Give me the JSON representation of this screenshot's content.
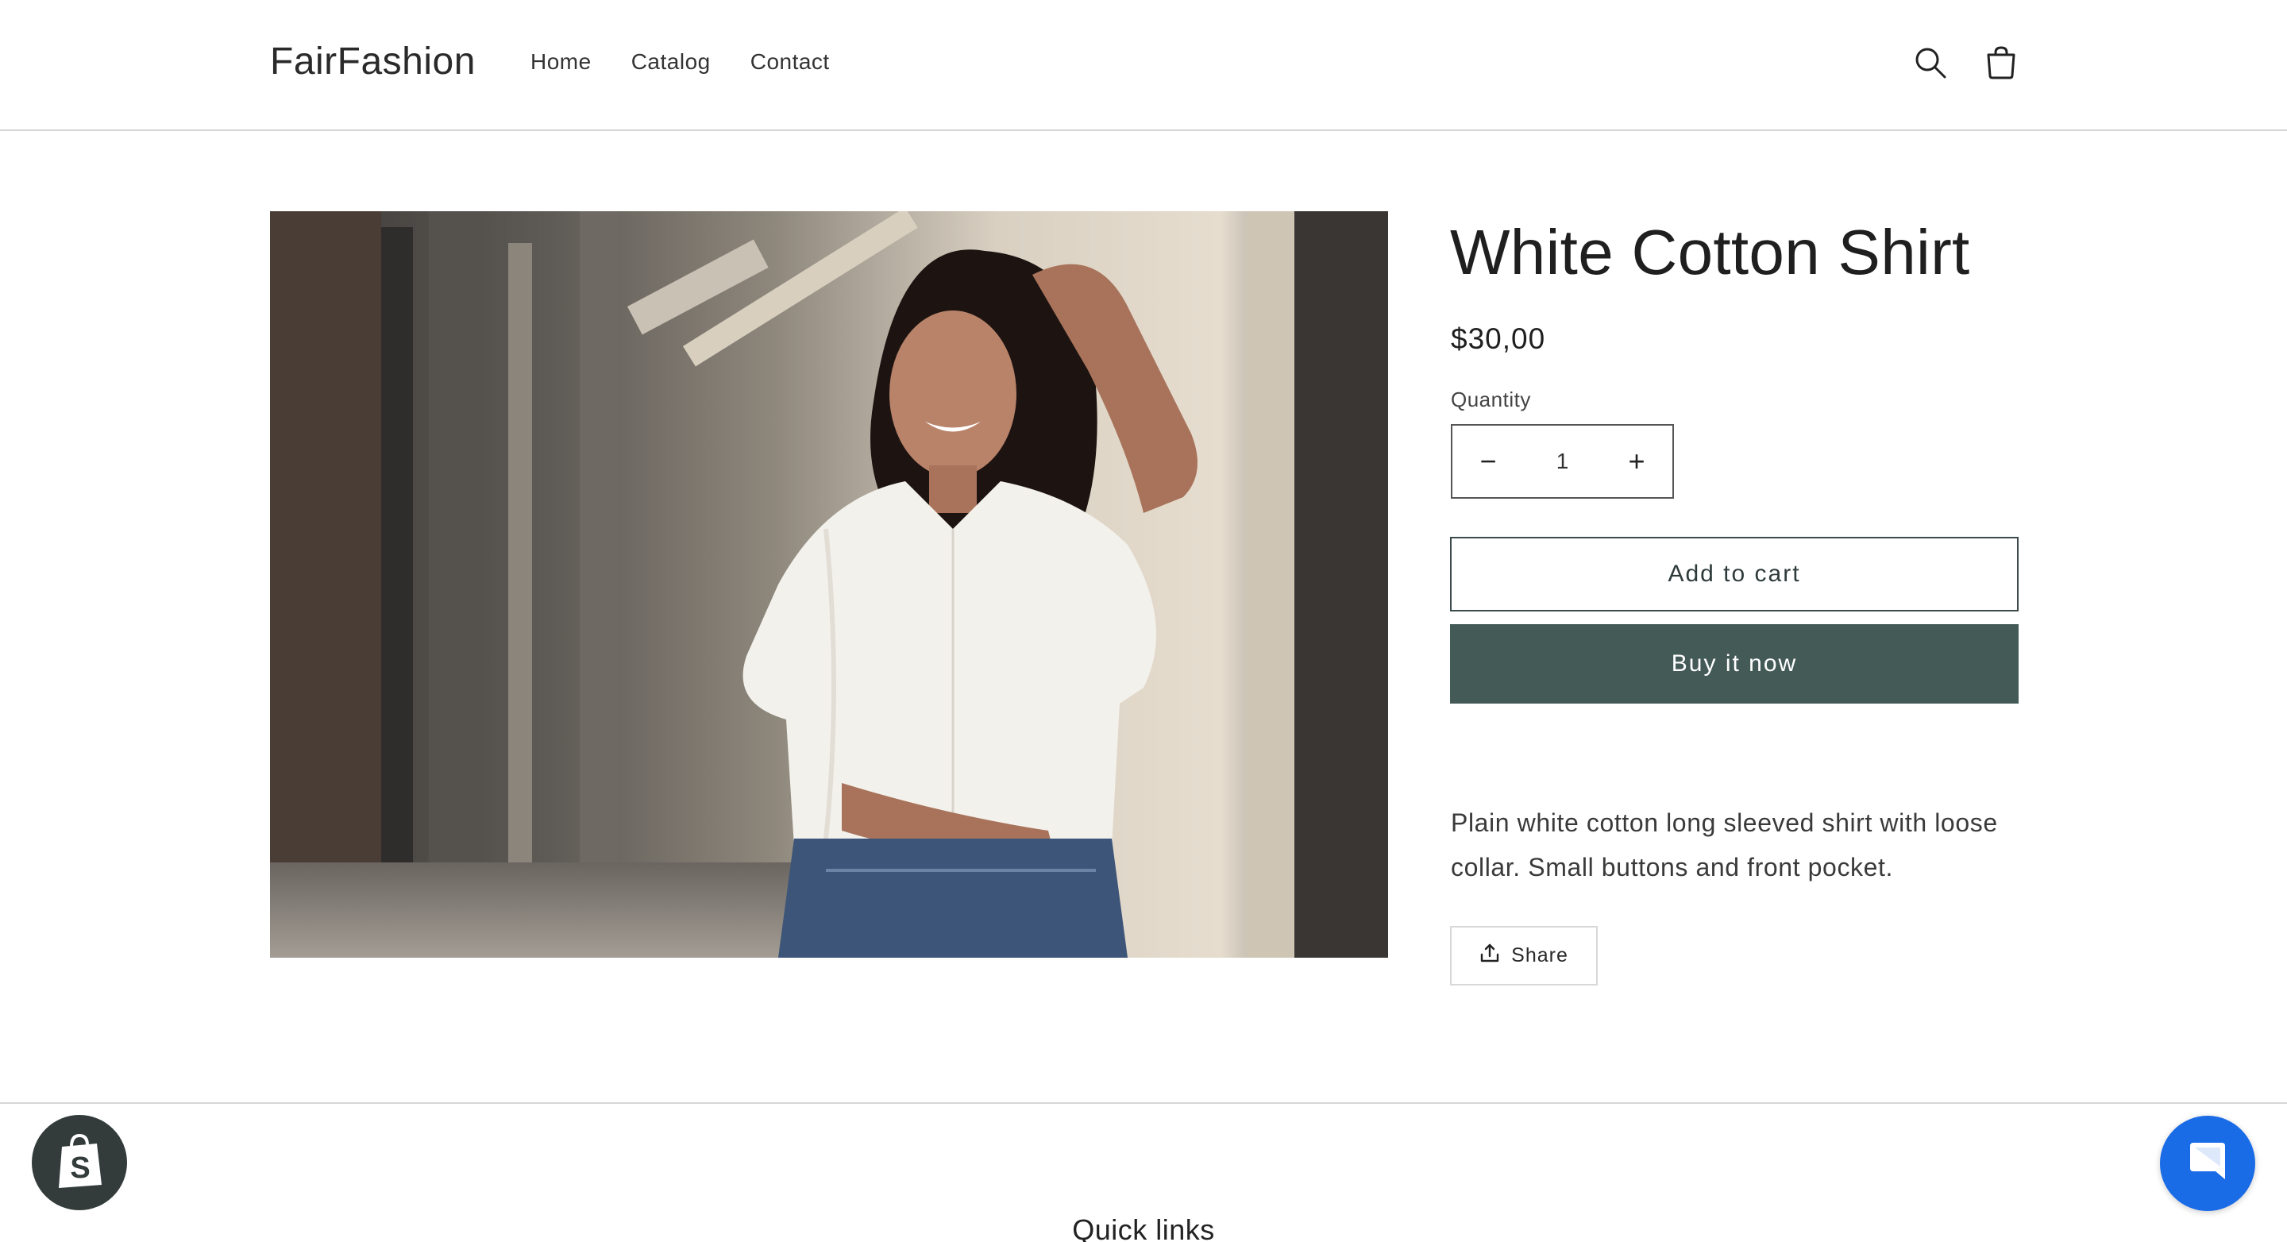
{
  "header": {
    "logo": "FairFashion",
    "nav": [
      {
        "label": "Home"
      },
      {
        "label": "Catalog"
      },
      {
        "label": "Contact"
      }
    ],
    "search_icon": "search-icon",
    "cart_icon": "cart-icon"
  },
  "product": {
    "title": "White Cotton Shirt",
    "price": "$30,00",
    "quantity_label": "Quantity",
    "quantity_value": "1",
    "decrease_symbol": "−",
    "increase_symbol": "+",
    "add_to_cart_label": "Add to cart",
    "buy_now_label": "Buy it now",
    "description": "Plain white cotton long sleeved shirt with loose collar. Small buttons and front pocket.",
    "share_label": "Share",
    "image_alt_icon": "product-photo"
  },
  "footer": {
    "quick_links_heading": "Quick links"
  },
  "colors": {
    "buy_button": "#445a56",
    "chat_bubble": "#1a6be6",
    "shopify_badge": "#333b3b"
  }
}
